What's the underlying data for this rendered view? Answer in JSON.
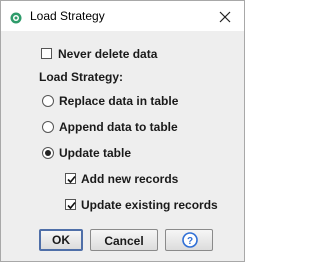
{
  "window": {
    "title": "Load Strategy",
    "app_icon": "app-logo-icon",
    "close_icon": "close-icon"
  },
  "options": {
    "never_delete": {
      "label": "Never delete data",
      "checked": false
    },
    "strategy_heading": "Load Strategy:",
    "strategies": [
      {
        "label": "Replace data in table",
        "selected": false
      },
      {
        "label": "Append data to table",
        "selected": false
      },
      {
        "label": "Update table",
        "selected": true
      }
    ],
    "update_options": [
      {
        "label": "Add new records",
        "checked": true
      },
      {
        "label": "Update existing records",
        "checked": true
      }
    ]
  },
  "buttons": {
    "ok": "OK",
    "cancel": "Cancel",
    "help_icon": "help-icon"
  },
  "colors": {
    "accent": "#2f6fd6",
    "app_icon": "#2e9b6a"
  }
}
